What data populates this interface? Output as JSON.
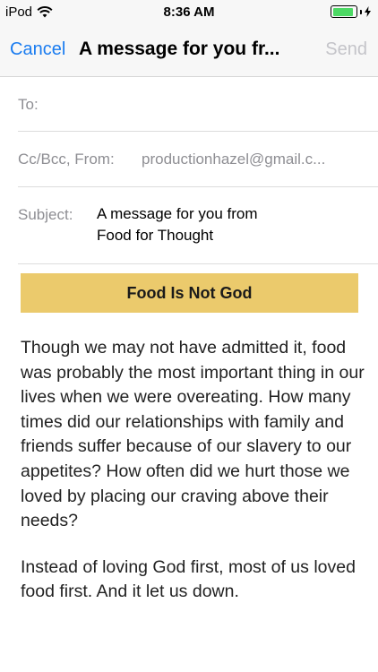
{
  "status_bar": {
    "carrier": "iPod",
    "time": "8:36 AM",
    "battery_level": 0.9,
    "battery_color": "#4cd964"
  },
  "nav": {
    "cancel_label": "Cancel",
    "title": "A message for you fr...",
    "send_label": "Send",
    "accent_color": "#1a7cf0"
  },
  "fields": {
    "to_label": "To:",
    "cc_label": "Cc/Bcc, From:",
    "from_value": "productionhazel@gmail.c...",
    "subject_label": "Subject:",
    "subject_line1": "A message for you from",
    "subject_line2": "Food for Thought"
  },
  "message": {
    "banner_title": "Food Is Not God",
    "banner_color": "#ebca6c",
    "paragraph1": "Though we may not have admitted it, food was probably the most important thing in our lives when we were overeating. How many times did our relationships with family and friends suffer because of our slavery to our appetites? How often did we hurt those we loved by placing our craving above their needs?",
    "paragraph2": "Instead of loving God first, most of us loved food first. And it let us down."
  }
}
